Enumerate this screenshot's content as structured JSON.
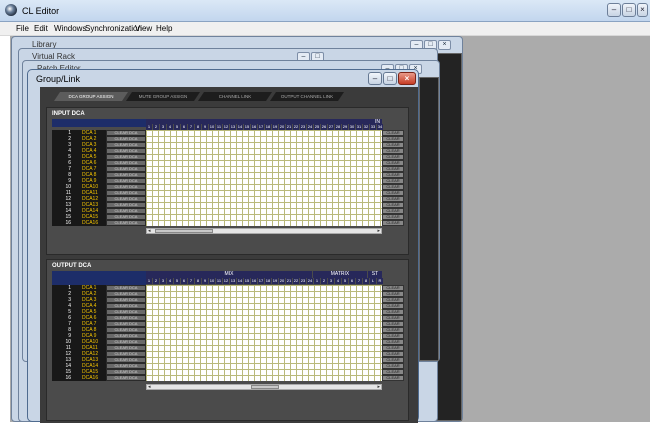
{
  "app": {
    "title": "CL Editor",
    "controls": [
      "–",
      "□",
      "×"
    ]
  },
  "menu": [
    "File",
    "Edit",
    "Windows",
    "Synchronization",
    "View",
    "Help"
  ],
  "windows": {
    "library": "Library",
    "virtual_rack": "Virtual Rack",
    "patch_editor": "Patch Editor",
    "group_link": "Group/Link"
  },
  "window_controls": [
    "–",
    "□",
    "×"
  ],
  "tabs": [
    "DCA GROUP ASSIGN",
    "MUTE GROUP ASSIGN",
    "CHANNEL LINK",
    "OUTPUT CHANNEL LINK"
  ],
  "input_dca": {
    "title": "INPUT DCA",
    "header_mark": "IN",
    "channels": [
      "1",
      "2",
      "3",
      "4",
      "5",
      "6",
      "7",
      "8",
      "9",
      "10",
      "11",
      "12",
      "13",
      "14",
      "15",
      "16",
      "17",
      "18",
      "19",
      "20",
      "21",
      "22",
      "23",
      "24",
      "25",
      "26",
      "27",
      "28",
      "29",
      "30",
      "31",
      "32",
      "33",
      "34"
    ],
    "rows": [
      {
        "num": "1",
        "name": "DCA 1",
        "btn": "CLEAR DCA",
        "clr": "CLEAR"
      },
      {
        "num": "2",
        "name": "DCA 2",
        "btn": "CLEAR DCA",
        "clr": "CLEAR"
      },
      {
        "num": "3",
        "name": "DCA 3",
        "btn": "CLEAR DCA",
        "clr": "CLEAR"
      },
      {
        "num": "4",
        "name": "DCA 4",
        "btn": "CLEAR DCA",
        "clr": "CLEAR"
      },
      {
        "num": "5",
        "name": "DCA 5",
        "btn": "CLEAR DCA",
        "clr": "CLEAR"
      },
      {
        "num": "6",
        "name": "DCA 6",
        "btn": "CLEAR DCA",
        "clr": "CLEAR"
      },
      {
        "num": "7",
        "name": "DCA 7",
        "btn": "CLEAR DCA",
        "clr": "CLEAR"
      },
      {
        "num": "8",
        "name": "DCA 8",
        "btn": "CLEAR DCA",
        "clr": "CLEAR"
      },
      {
        "num": "9",
        "name": "DCA 9",
        "btn": "CLEAR DCA",
        "clr": "CLEAR"
      },
      {
        "num": "10",
        "name": "DCA10",
        "btn": "CLEAR DCA",
        "clr": "CLEAR"
      },
      {
        "num": "11",
        "name": "DCA11",
        "btn": "CLEAR DCA",
        "clr": "CLEAR"
      },
      {
        "num": "12",
        "name": "DCA12",
        "btn": "CLEAR DCA",
        "clr": "CLEAR"
      },
      {
        "num": "13",
        "name": "DCA13",
        "btn": "CLEAR DCA",
        "clr": "CLEAR"
      },
      {
        "num": "14",
        "name": "DCA14",
        "btn": "CLEAR DCA",
        "clr": "CLEAR"
      },
      {
        "num": "15",
        "name": "DCA15",
        "btn": "CLEAR DCA",
        "clr": "CLEAR"
      },
      {
        "num": "16",
        "name": "DCA16",
        "btn": "CLEAR DCA",
        "clr": "CLEAR"
      }
    ]
  },
  "output_dca": {
    "title": "OUTPUT DCA",
    "group_labels": {
      "mix": "MIX",
      "matrix": "MATRIX",
      "st": "ST"
    },
    "mix_channels": [
      "1",
      "2",
      "3",
      "4",
      "5",
      "6",
      "7",
      "8",
      "9",
      "10",
      "11",
      "12",
      "13",
      "14",
      "15",
      "16",
      "17",
      "18",
      "19",
      "20",
      "21",
      "22",
      "23",
      "24"
    ],
    "matrix_channels": [
      "1",
      "2",
      "3",
      "4",
      "5",
      "6",
      "7",
      "8"
    ],
    "st_channels": [
      "L",
      "R"
    ],
    "rows": [
      {
        "num": "1",
        "name": "DCA 1",
        "btn": "CLEAR DCA",
        "clr": "CLEAR"
      },
      {
        "num": "2",
        "name": "DCA 2",
        "btn": "CLEAR DCA",
        "clr": "CLEAR"
      },
      {
        "num": "3",
        "name": "DCA 3",
        "btn": "CLEAR DCA",
        "clr": "CLEAR"
      },
      {
        "num": "4",
        "name": "DCA 4",
        "btn": "CLEAR DCA",
        "clr": "CLEAR"
      },
      {
        "num": "5",
        "name": "DCA 5",
        "btn": "CLEAR DCA",
        "clr": "CLEAR"
      },
      {
        "num": "6",
        "name": "DCA 6",
        "btn": "CLEAR DCA",
        "clr": "CLEAR"
      },
      {
        "num": "7",
        "name": "DCA 7",
        "btn": "CLEAR DCA",
        "clr": "CLEAR"
      },
      {
        "num": "8",
        "name": "DCA 8",
        "btn": "CLEAR DCA",
        "clr": "CLEAR"
      },
      {
        "num": "9",
        "name": "DCA 9",
        "btn": "CLEAR DCA",
        "clr": "CLEAR"
      },
      {
        "num": "10",
        "name": "DCA10",
        "btn": "CLEAR DCA",
        "clr": "CLEAR"
      },
      {
        "num": "11",
        "name": "DCA11",
        "btn": "CLEAR DCA",
        "clr": "CLEAR"
      },
      {
        "num": "12",
        "name": "DCA12",
        "btn": "CLEAR DCA",
        "clr": "CLEAR"
      },
      {
        "num": "13",
        "name": "DCA13",
        "btn": "CLEAR DCA",
        "clr": "CLEAR"
      },
      {
        "num": "14",
        "name": "DCA14",
        "btn": "CLEAR DCA",
        "clr": "CLEAR"
      },
      {
        "num": "15",
        "name": "DCA15",
        "btn": "CLEAR DCA",
        "clr": "CLEAR"
      },
      {
        "num": "16",
        "name": "DCA16",
        "btn": "CLEAR DCA",
        "clr": "CLEAR"
      }
    ]
  },
  "colors": {
    "grid_line": "#b9b97a",
    "dca_name": "#f4c400",
    "panel": "#4b4b4b",
    "header": "#27285a"
  }
}
